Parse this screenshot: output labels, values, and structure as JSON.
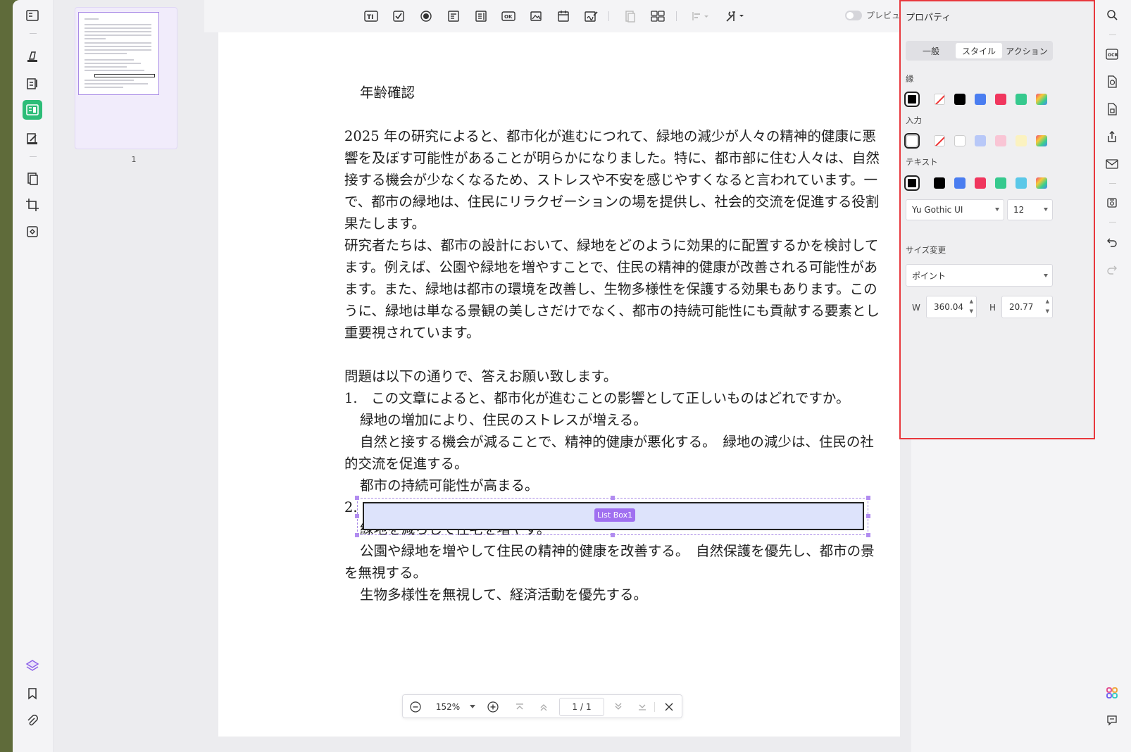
{
  "toolbar": {
    "preview_label": "プレビュー"
  },
  "thumbnail": {
    "page_number": "1"
  },
  "document": {
    "title": "年齢確認",
    "lines": [
      "2025 年の研究によると、都市化が進むにつれて、緑地の減少が人々の精神的健康に悪",
      "響を及ぼす可能性があることが明らかになりました。特に、都市部に住む人々は、自然",
      "接する機会が少なくなるため、ストレスや不安を感じやすくなると言われています。一",
      "で、都市の緑地は、住民にリラクゼーションの場を提供し、社会的交流を促進する役割",
      "果たします。",
      "研究者たちは、都市の設計において、緑地をどのように効果的に配置するかを検討して",
      "ます。例えば、公園や緑地を増やすことで、住民の精神的健康が改善される可能性があ",
      "ます。また、緑地は都市の環境を改善し、生物多様性を保護する効果もあります。この",
      "うに、緑地は単なる景観の美しさだけでなく、都市の持続可能性にも貢献する要素とし",
      "重要視されています。"
    ],
    "question_intro": "問題は以下の通りで、答えお願い致します。",
    "q1": "1.　この文章によると、都市化が進むことの影響として正しいものはどれですか。",
    "q1_a": "緑地の増加により、住民のストレスが増える。",
    "q1_b": "自然と接する機会が減ることで、精神的健康が悪化する。　緑地の減少は、住民の社",
    "q1_b2": "的交流を促進する。",
    "q1_c": "都市の持続可能性が高まる。",
    "q2_num": "2.",
    "q2_a": "緑地を減らして住宅を増やす。",
    "q2_b": "公園や緑地を増やして住民の精神的健康を改善する。　自然保護を優先し、都市の景",
    "q2_b2": "を無視する。",
    "q2_c": "生物多様性を無視して、経済活動を優先する。",
    "listbox_label": "List Box1"
  },
  "zoombar": {
    "zoom": "152%",
    "page_current": "1",
    "page_sep": "/",
    "page_total": "1"
  },
  "properties": {
    "title": "プロパティ",
    "tabs": [
      "一般",
      "スタイル",
      "アクション"
    ],
    "active_tab": "スタイル",
    "border_label": "縁",
    "fill_label": "入力",
    "text_label": "テキスト",
    "border_colors": [
      "#000000",
      "none",
      "#000000",
      "#4a7df0",
      "#f0365e",
      "#36c98e",
      "gradient"
    ],
    "fill_colors": [
      "#ffffff",
      "none",
      "#ffffff",
      "#b8c8f8",
      "#f9c5d5",
      "#fbf2c0",
      "gradient"
    ],
    "text_colors": [
      "#000000",
      "#000000",
      "#4a7df0",
      "#f0365e",
      "#36c98e",
      "#5bc8e8",
      "gradient"
    ],
    "font": "Yu Gothic UI",
    "font_size": "12",
    "resize_label": "サイズ変更",
    "unit": "ポイント",
    "w_label": "W",
    "w_value": "360.04",
    "h_label": "H",
    "h_value": "20.77"
  },
  "colors": {
    "accent": "#a070f0",
    "highlight_border": "#e8383d",
    "active_green": "#2dbd78"
  }
}
